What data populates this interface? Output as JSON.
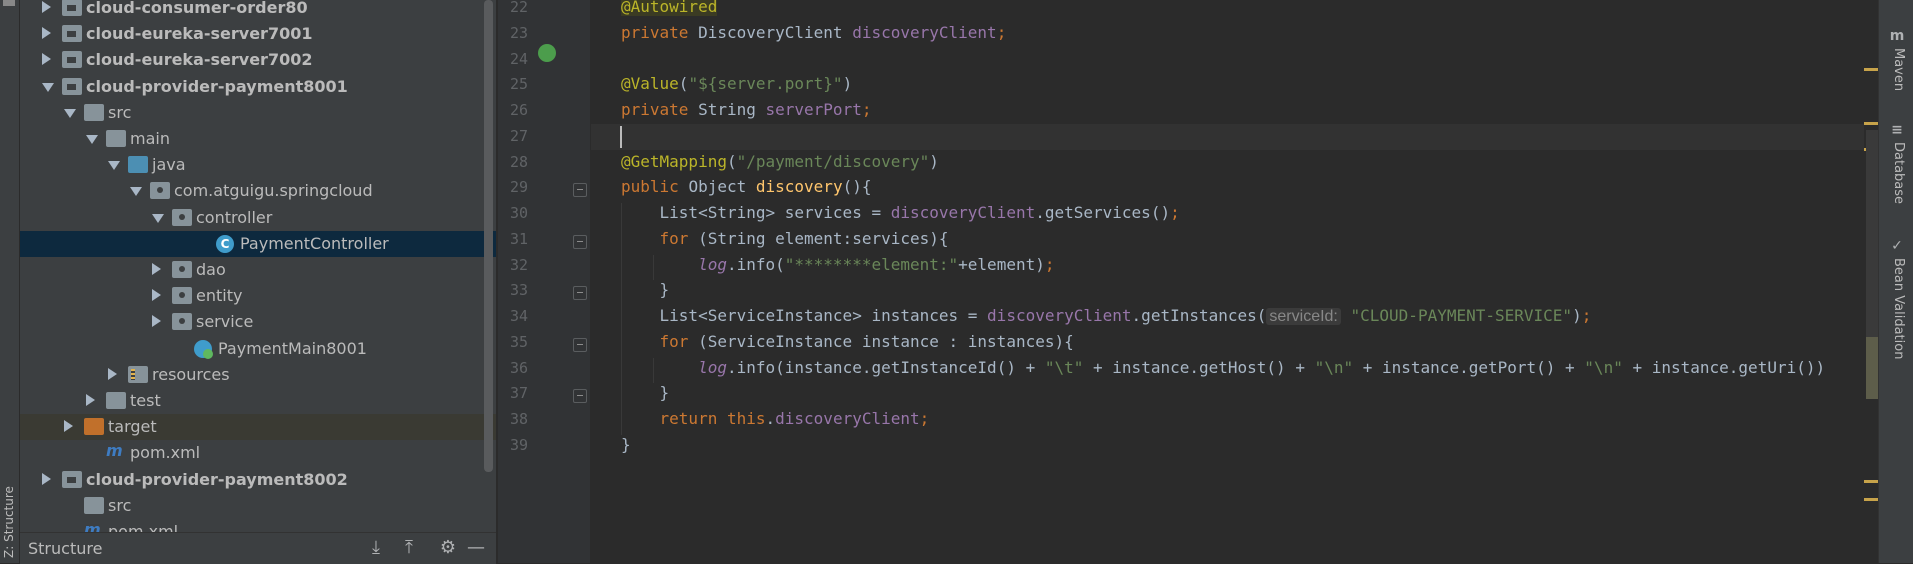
{
  "left_strip": {
    "label": "Z: Structure"
  },
  "project_tree": [
    {
      "label": "cloud-consumer-order80",
      "bold": true,
      "indent": 0,
      "arrow": "right",
      "icon": "module-folder-icon"
    },
    {
      "label": "cloud-eureka-server7001",
      "bold": true,
      "indent": 0,
      "arrow": "right",
      "icon": "module-folder-icon"
    },
    {
      "label": "cloud-eureka-server7002",
      "bold": true,
      "indent": 0,
      "arrow": "right",
      "icon": "module-folder-icon"
    },
    {
      "label": "cloud-provider-payment8001",
      "bold": true,
      "indent": 0,
      "arrow": "down",
      "icon": "module-folder-icon"
    },
    {
      "label": "src",
      "bold": false,
      "indent": 1,
      "arrow": "down",
      "icon": "folder-icon"
    },
    {
      "label": "main",
      "bold": false,
      "indent": 2,
      "arrow": "down",
      "icon": "folder-icon"
    },
    {
      "label": "java",
      "bold": false,
      "indent": 3,
      "arrow": "down",
      "icon": "source-folder-icon"
    },
    {
      "label": "com.atguigu.springcloud",
      "bold": false,
      "indent": 4,
      "arrow": "down",
      "icon": "package-icon"
    },
    {
      "label": "controller",
      "bold": false,
      "indent": 5,
      "arrow": "down",
      "icon": "package-icon"
    },
    {
      "label": "PaymentController",
      "bold": false,
      "indent": 7,
      "arrow": "none",
      "icon": "class-icon",
      "selected": true
    },
    {
      "label": "dao",
      "bold": false,
      "indent": 5,
      "arrow": "right",
      "icon": "package-icon"
    },
    {
      "label": "entity",
      "bold": false,
      "indent": 5,
      "arrow": "right",
      "icon": "package-icon"
    },
    {
      "label": "service",
      "bold": false,
      "indent": 5,
      "arrow": "right",
      "icon": "package-icon"
    },
    {
      "label": "PaymentMain8001",
      "bold": false,
      "indent": 6,
      "arrow": "none",
      "icon": "main-class-icon"
    },
    {
      "label": "resources",
      "bold": false,
      "indent": 3,
      "arrow": "right",
      "icon": "resources-folder-icon"
    },
    {
      "label": "test",
      "bold": false,
      "indent": 2,
      "arrow": "right",
      "icon": "folder-icon"
    },
    {
      "label": "target",
      "bold": false,
      "indent": 1,
      "arrow": "right",
      "icon": "excluded-folder-icon",
      "target": true
    },
    {
      "label": "pom.xml",
      "bold": false,
      "indent": 2,
      "arrow": "none",
      "icon": "maven-icon"
    },
    {
      "label": "cloud-provider-payment8002",
      "bold": true,
      "indent": 0,
      "arrow": "right",
      "icon": "module-folder-icon"
    },
    {
      "label": "src",
      "bold": false,
      "indent": 1,
      "arrow": "none",
      "icon": "folder-icon"
    },
    {
      "label": "pom.xml",
      "bold": false,
      "indent": 1,
      "arrow": "none",
      "icon": "maven-icon"
    }
  ],
  "structure_bar": {
    "title": "Structure",
    "tools": [
      "expand-all-icon",
      "collapse-all-icon",
      "gear-icon",
      "minimize-icon"
    ]
  },
  "editor": {
    "line_numbers": [
      "22",
      "23",
      "24",
      "25",
      "26",
      "27",
      "28",
      "29",
      "30",
      "31",
      "32",
      "33",
      "34",
      "35",
      "36",
      "37",
      "38",
      "39"
    ],
    "current_line": "27",
    "lines": [
      [
        [
          "ann-hl",
          "@Autowired"
        ]
      ],
      [
        [
          "kw",
          "private "
        ],
        [
          "",
          "DiscoveryClient "
        ],
        [
          "fld",
          "discoveryClient"
        ],
        [
          "kw",
          ";"
        ]
      ],
      [],
      [
        [
          "ann",
          "@Value"
        ],
        [
          "",
          "("
        ],
        [
          "str",
          "\"${server.port}\""
        ],
        [
          "",
          ")"
        ]
      ],
      [
        [
          "kw",
          "private "
        ],
        [
          "",
          "String "
        ],
        [
          "fld",
          "serverPort"
        ],
        [
          "kw",
          ";"
        ]
      ],
      [],
      [
        [
          "ann",
          "@GetMapping"
        ],
        [
          "",
          "("
        ],
        [
          "str",
          "\"/payment/discovery\""
        ],
        [
          "",
          ")"
        ]
      ],
      [
        [
          "kw",
          "public "
        ],
        [
          "",
          "Object "
        ],
        [
          "mth",
          "discovery"
        ],
        [
          "",
          "(){"
        ]
      ],
      [
        [
          "",
          "    List<String> services = "
        ],
        [
          "fld",
          "discoveryClient"
        ],
        [
          "",
          ".getServices()"
        ],
        [
          "kw",
          ";"
        ]
      ],
      [
        [
          "kw",
          "    for "
        ],
        [
          "",
          "(String element:services){"
        ]
      ],
      [
        [
          "",
          "        "
        ],
        [
          "stat",
          "log"
        ],
        [
          "",
          ".info("
        ],
        [
          "str",
          "\"********element:\""
        ],
        [
          "",
          "+element)"
        ],
        [
          "kw",
          ";"
        ]
      ],
      [
        [
          "",
          "    }"
        ]
      ],
      [
        [
          "",
          "    List<ServiceInstance> instances = "
        ],
        [
          "fld",
          "discoveryClient"
        ],
        [
          "",
          ".getInstances("
        ],
        [
          "hint",
          "serviceId:"
        ],
        [
          "str",
          " \"CLOUD-PAYMENT-SERVICE\""
        ],
        [
          "",
          ")"
        ],
        [
          "kw",
          ";"
        ]
      ],
      [
        [
          "kw",
          "    for "
        ],
        [
          "",
          "(ServiceInstance instance : instances){"
        ]
      ],
      [
        [
          "",
          "        "
        ],
        [
          "stat",
          "log"
        ],
        [
          "",
          ".info(instance.getInstanceId() + "
        ],
        [
          "str",
          "\"\\t\""
        ],
        [
          "",
          " + instance.getHost() + "
        ],
        [
          "str",
          "\"\\n\""
        ],
        [
          "",
          " + instance.getPort() + "
        ],
        [
          "str",
          "\"\\n\""
        ],
        [
          "",
          " + instance.getUri())"
        ]
      ],
      [
        [
          "",
          "    }"
        ]
      ],
      [
        [
          "kw",
          "    return this"
        ],
        [
          "",
          "."
        ],
        [
          "fld",
          "discoveryClient"
        ],
        [
          "kw",
          ";"
        ]
      ],
      [
        [
          "",
          "}"
        ]
      ]
    ]
  },
  "right_bar": [
    {
      "label": "Maven",
      "icon": "maven-icon",
      "glyph": "m"
    },
    {
      "label": "Database",
      "icon": "database-icon",
      "glyph": "≡"
    },
    {
      "label": "Bean Validation",
      "icon": "bean-validation-icon",
      "glyph": "✓"
    }
  ],
  "colors": {
    "editor_bg": "#2b2b2b",
    "panel_bg": "#3c3f41",
    "keyword": "#cc7832",
    "annotation": "#bbb529",
    "field": "#9876aa",
    "string": "#6a8759",
    "method": "#ffc66d",
    "selection": "#0d293e"
  }
}
